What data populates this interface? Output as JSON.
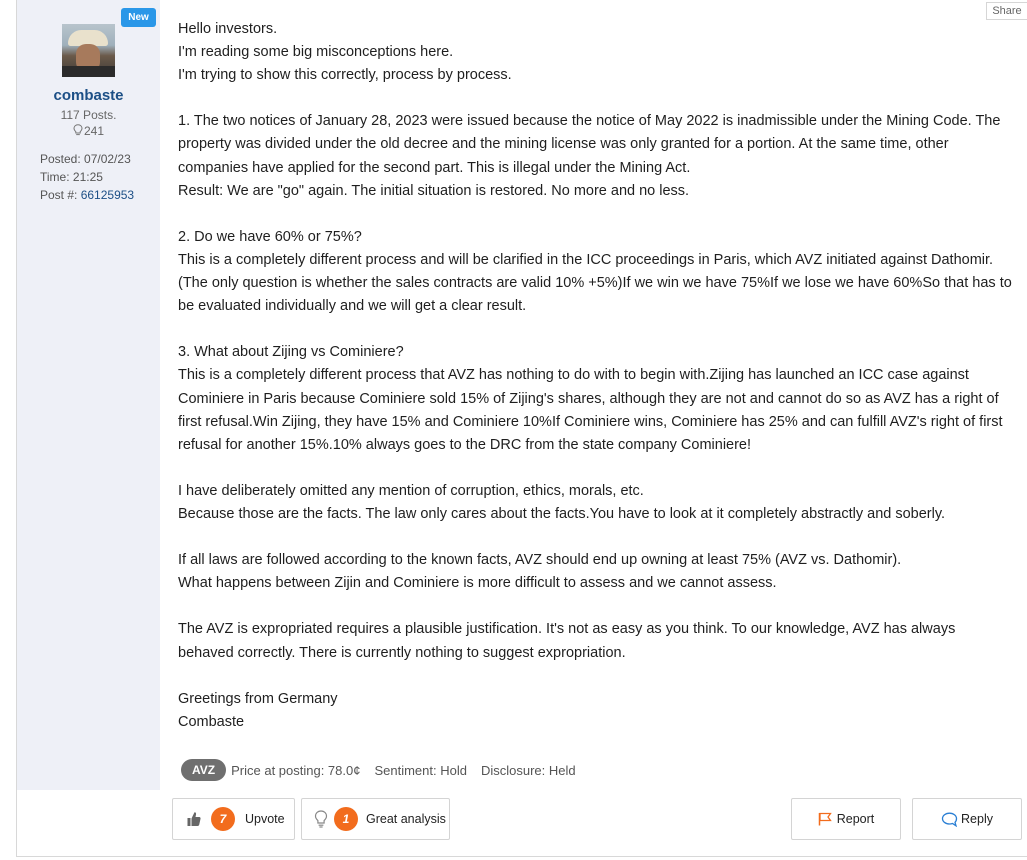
{
  "author": {
    "badge": "New",
    "username": "combaste",
    "posts": "117 Posts.",
    "likes": "241",
    "posted": "Posted: 07/02/23",
    "time": "Time: 21:25",
    "post_label": "Post #:",
    "post_number": "66125953"
  },
  "share_label": "Share",
  "body": {
    "paragraphs": [
      "Hello investors.\nI'm reading some big misconceptions here.\nI'm trying to show this correctly, process by process.",
      "1. The two notices of January 28, 2023 were issued because the notice of May 2022 is inadmissible under the Mining Code. The property was divided under the old decree and the mining license was only granted for a portion. At the same time, other companies have applied for the second part. This is illegal under the Mining Act.\nResult: We are \"go\" again. The initial situation is restored. No more and no less.",
      "2. Do we have 60% or 75%?\nThis is a completely different process and will be clarified in the ICC proceedings in Paris, which AVZ initiated against Dathomir. (The only question is whether the sales contracts are valid 10% +5%)If we win we have 75%If we lose we have 60%So that has to be evaluated individually and we will get a clear result.",
      "3. What about Zijing vs Cominiere?\nThis is a completely different process that AVZ has nothing to do with to begin with.Zijing has launched an ICC case against Cominiere in Paris because Cominiere sold 15% of Zijing's shares, although they are not and cannot do so as AVZ has a right of first refusal.Win Zijing, they have 15% and Cominiere 10%If Cominiere wins, Cominiere has 25% and can fulfill AVZ's right of first refusal for another 15%.10% always goes to the DRC from the state company Cominiere!",
      "I have deliberately omitted any mention of corruption, ethics, morals, etc.\nBecause those are the facts. The law only cares about the facts.You have to look at it completely abstractly and soberly.",
      "If all laws are followed according to the known facts, AVZ should end up owning at least 75% (AVZ vs. Dathomir).\nWhat happens between Zijin and Cominiere is more difficult to assess and we cannot assess.",
      "The AVZ is expropriated requires a plausible justification. It's not as easy as you think. To our knowledge, AVZ has always behaved correctly. There is currently nothing to suggest expropriation.",
      "Greetings from Germany\nCombaste"
    ]
  },
  "tags": {
    "ticker": "AVZ",
    "price": "Price at posting: 78.0¢",
    "sentiment": "Sentiment: Hold",
    "disclosure": "Disclosure: Held"
  },
  "actions": {
    "upvote_count": "7",
    "upvote_label": "Upvote",
    "analysis_count": "1",
    "analysis_label": "Great analysis",
    "report_label": "Report",
    "reply_label": "Reply"
  },
  "colors": {
    "accent_orange": "#f26c1d",
    "username_blue": "#1c4f86",
    "badge_blue": "#2a97e8",
    "sidebar_bg": "#eef0f7"
  }
}
